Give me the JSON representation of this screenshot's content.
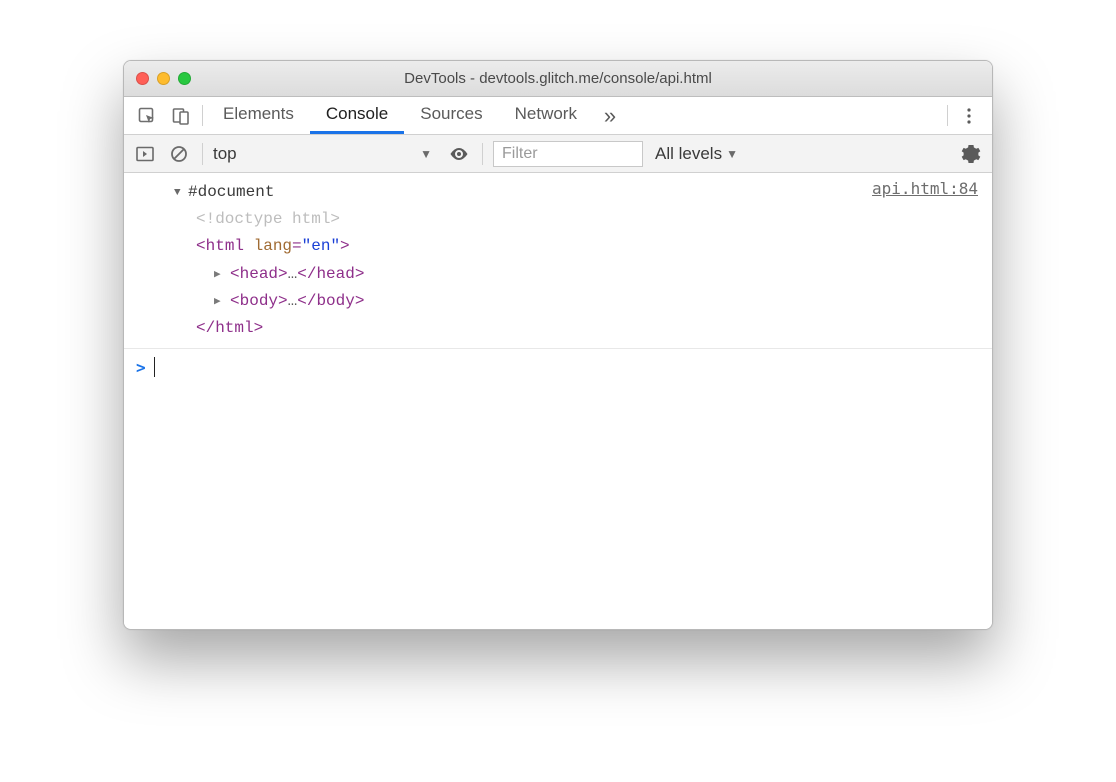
{
  "window": {
    "title": "DevTools - devtools.glitch.me/console/api.html"
  },
  "tabs": {
    "elements": "Elements",
    "console": "Console",
    "sources": "Sources",
    "network": "Network",
    "more_glyph": "»"
  },
  "console_toolbar": {
    "context": "top",
    "filter_placeholder": "Filter",
    "levels": "All levels"
  },
  "log": {
    "source": "api.html:84",
    "root": "#document",
    "doctype": "<!doctype html>",
    "html_open_tag": "html",
    "html_attr_name": "lang",
    "html_attr_value": "\"en\"",
    "head_tag": "head",
    "body_tag": "body",
    "ellipsis": "…",
    "html_close": "</html>"
  },
  "prompt": {
    "caret": ">"
  }
}
